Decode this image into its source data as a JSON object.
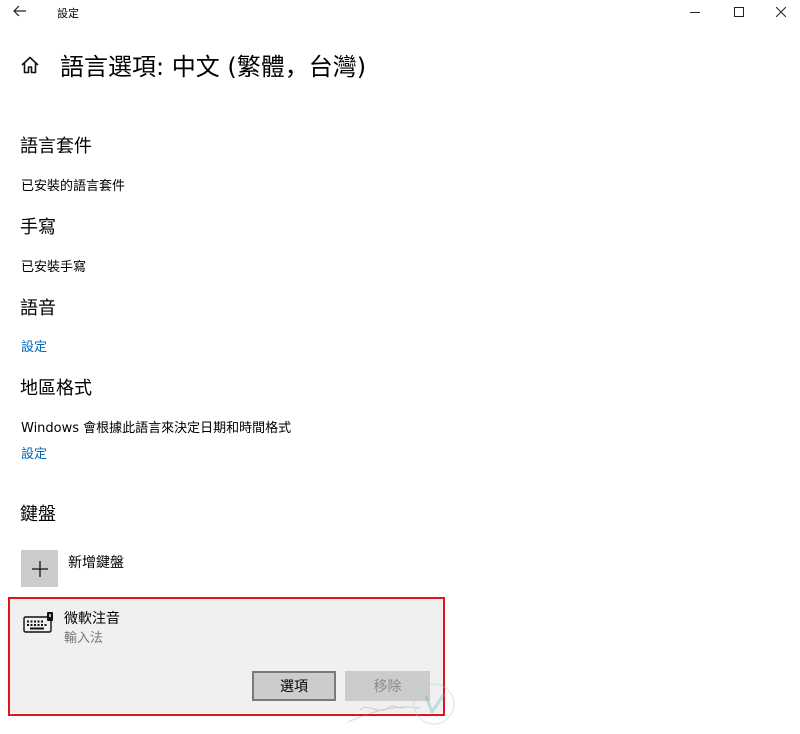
{
  "window": {
    "title": "設定"
  },
  "page": {
    "title": "語言選項: 中文 (繁體，台灣)"
  },
  "sections": {
    "language_pack": {
      "heading": "語言套件",
      "status": "已安裝的語言套件"
    },
    "handwriting": {
      "heading": "手寫",
      "status": "已安裝手寫"
    },
    "speech": {
      "heading": "語音",
      "link": "設定"
    },
    "regional_format": {
      "heading": "地區格式",
      "description": "Windows 會根據此語言來決定日期和時間格式",
      "link": "設定"
    },
    "keyboard": {
      "heading": "鍵盤",
      "add_label": "新增鍵盤",
      "items": [
        {
          "name": "微軟注音",
          "subtitle": "輸入法",
          "options_label": "選項",
          "remove_label": "移除",
          "icon": "keyboard-icon"
        }
      ]
    }
  },
  "colors": {
    "link": "#0067b8",
    "highlight_frame": "#e0141b",
    "selected_bg": "#f0f0f0",
    "button_bg": "#cccccc"
  }
}
